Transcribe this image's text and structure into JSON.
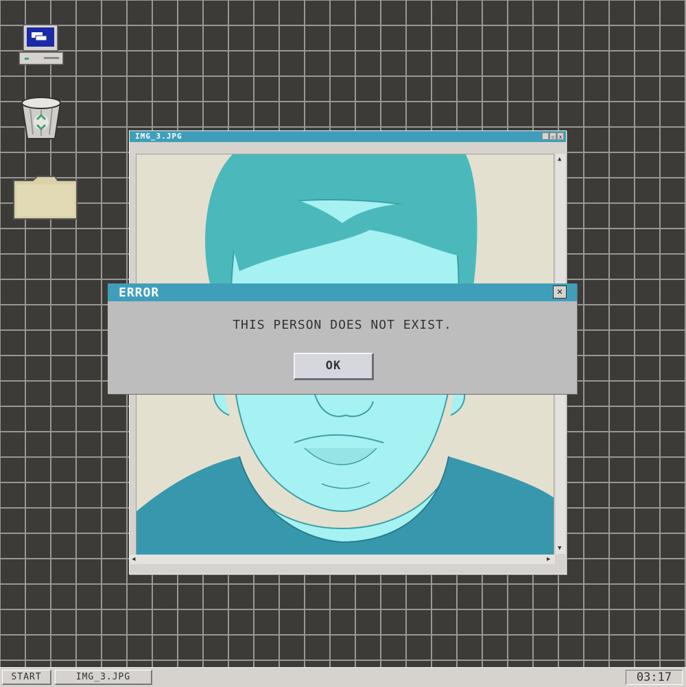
{
  "desktop": {
    "icons": [
      "computer-icon",
      "recycle-bin-icon",
      "folder-icon"
    ]
  },
  "window": {
    "title": "IMG_3.JPG",
    "controls": {
      "minimize": "_",
      "maximize": "▫",
      "close": "x"
    },
    "image": "portrait-image"
  },
  "dialog": {
    "title": "ERROR",
    "close": "✕",
    "message": "THIS PERSON DOES NOT EXIST.",
    "ok_label": "OK"
  },
  "taskbar": {
    "start_label": "START",
    "task_label": "IMG_3.JPG",
    "clock": "03:17"
  },
  "colors": {
    "desktop": "#3d3b37",
    "grid": "#9a9892",
    "titlebar": "#3f9fba",
    "dialog": "#bdbdbd",
    "face": "#a6f1f1",
    "hair": "#4bb9bb",
    "shirt": "#3798ad"
  }
}
